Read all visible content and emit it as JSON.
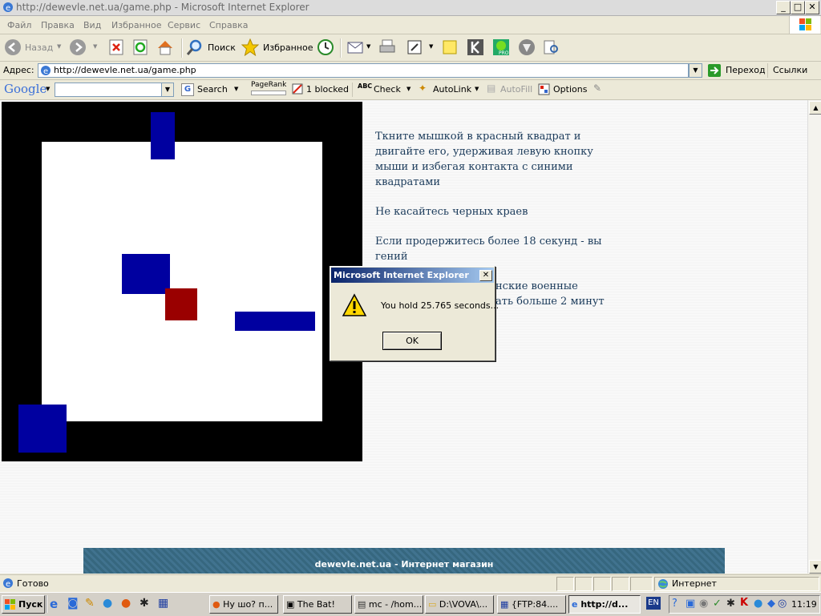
{
  "window": {
    "title": "http://dewevle.net.ua/game.php - Microsoft Internet Explorer",
    "min": "_",
    "max": "□",
    "close": "✕"
  },
  "menu": [
    "Файл",
    "Правка",
    "Вид",
    "Избранное",
    "Сервис",
    "Справка"
  ],
  "toolbar": {
    "back": "Назад",
    "search": "Поиск",
    "favorites": "Избранное"
  },
  "address": {
    "label": "Адрес:",
    "url": "http://dewevle.net.ua/game.php",
    "go": "Переход",
    "links": "Ссылки"
  },
  "google_bar": {
    "logo": "Google",
    "search": "Search",
    "pagerank": "PageRank",
    "blocked": "1 blocked",
    "check": "Check",
    "autolink": "AutoLink",
    "autofill": "AutoFill",
    "options": "Options"
  },
  "page": {
    "instructions": [
      "Ткните мышкой в красный квадрат и двигайте его, удерживая левую кнопку мыши и избегая контакта с синими квадратами",
      "Не касайтесь черных краев",
      "Если продержитесь более 18 секунд - вы гений",
      "нские военные",
      "ать больше 2 минут"
    ],
    "banner": "dewevle.net.ua - Интернет магазин"
  },
  "dialog": {
    "title": "Microsoft Internet Explorer",
    "message": "You hold 25.765 seconds...",
    "ok": "OK"
  },
  "status": {
    "text": "Готово",
    "zone": "Интернет"
  },
  "taskbar": {
    "start": "Пуск",
    "tasks": [
      "Ну шо? п...",
      "The Bat!",
      "mc - /hom...",
      "D:\\VOVA\\...",
      "{FTP:84....",
      "http://d..."
    ],
    "lang": "EN",
    "clock": "11:19"
  },
  "colors": {
    "blue": "#0000a0",
    "red": "#9a0000",
    "dialog_title": "#0a246a"
  }
}
